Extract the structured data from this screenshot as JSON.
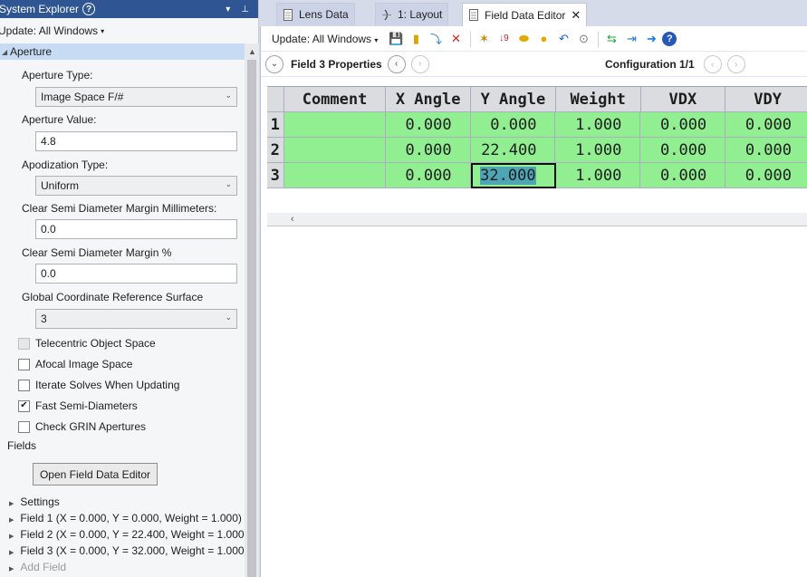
{
  "left_panel": {
    "title": "System Explorer",
    "help_icon": "question-mark",
    "title_actions": [
      "▾",
      "⊥"
    ],
    "update_label": "Update: All Windows",
    "aperture_section": "Aperture",
    "aperture_type_label": "Aperture Type:",
    "aperture_type_value": "Image Space F/#",
    "aperture_value_label": "Aperture Value:",
    "aperture_value": "4.8",
    "apodization_label": "Apodization Type:",
    "apodization_value": "Uniform",
    "clear_mm_label": "Clear Semi Diameter Margin Millimeters:",
    "clear_mm_value": "0.0",
    "clear_pct_label": "Clear Semi Diameter Margin %",
    "clear_pct_value": "0.0",
    "global_ref_label": "Global Coordinate Reference Surface",
    "global_ref_value": "3",
    "checkboxes": [
      {
        "label": "Telecentric Object Space",
        "checked": false,
        "disabled": true
      },
      {
        "label": "Afocal Image Space",
        "checked": false,
        "disabled": false
      },
      {
        "label": "Iterate Solves When Updating",
        "checked": false,
        "disabled": false
      },
      {
        "label": "Fast Semi-Diameters",
        "checked": true,
        "disabled": false
      },
      {
        "label": "Check GRIN Apertures",
        "checked": false,
        "disabled": false
      }
    ],
    "fields_section": "Fields",
    "open_fde_label": "Open Field Data Editor",
    "tree": [
      "Settings",
      "Field 1 (X = 0.000, Y = 0.000, Weight = 1.000)",
      "Field 2 (X = 0.000, Y = 22.400, Weight = 1.000)",
      "Field 3 (X = 0.000, Y = 32.000, Weight = 1.000)",
      "Add Field"
    ]
  },
  "tabs": [
    {
      "label": "Lens Data",
      "icon": "document-icon",
      "active": false
    },
    {
      "label": "1: Layout",
      "icon": "lens-icon",
      "active": false
    },
    {
      "label": "Field Data Editor",
      "icon": "document-icon",
      "active": true
    }
  ],
  "editor": {
    "update_label": "Update: All Windows",
    "toolbar_icons": [
      "save-icon",
      "open-folder-icon",
      "insert-icon",
      "delete-icon",
      "wand-icon",
      "sort-icon",
      "sphere-icon",
      "sphere-orange-icon",
      "undo-icon",
      "toggle-icon",
      "swap-icon",
      "compress-icon",
      "arrow-right-icon",
      "help-icon"
    ],
    "properties_title": "Field  3 Properties",
    "configuration_title": "Configuration 1/1",
    "columns": [
      "Comment",
      "X Angle",
      "Y Angle",
      "Weight",
      "VDX",
      "VDY"
    ],
    "rows": [
      {
        "num": "1",
        "comment": "",
        "x": "0.000",
        "y": "0.000",
        "weight": "1.000",
        "vdx": "0.000",
        "vdy": "0.000"
      },
      {
        "num": "2",
        "comment": "",
        "x": "0.000",
        "y": "22.400",
        "weight": "1.000",
        "vdx": "0.000",
        "vdy": "0.000"
      },
      {
        "num": "3",
        "comment": "",
        "x": "0.000",
        "y": "32.000",
        "weight": "1.000",
        "vdx": "0.000",
        "vdy": "0.000"
      }
    ],
    "selected_cell": {
      "row": 3,
      "column": "Y Angle"
    }
  }
}
